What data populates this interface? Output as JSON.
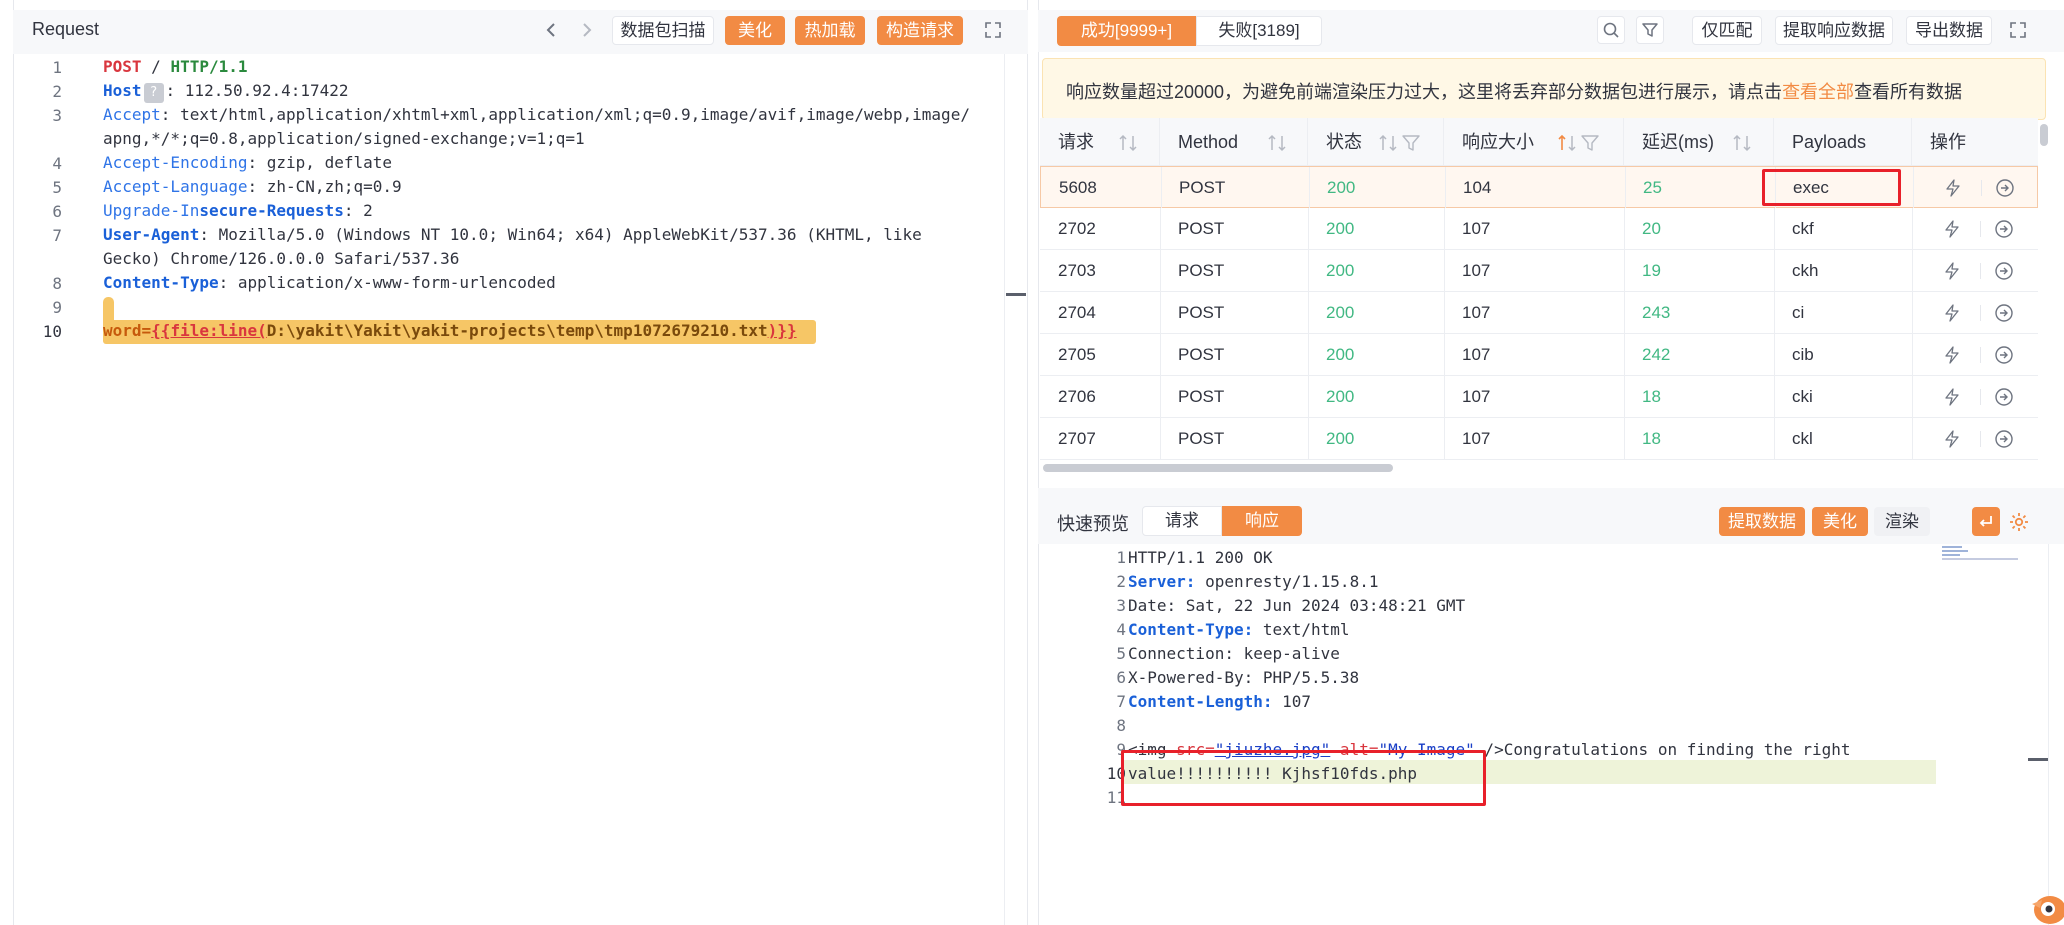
{
  "request_panel": {
    "title": "Request",
    "toolbar": {
      "scan_label": "数据包扫描",
      "beautify_label": "美化",
      "hot_load_label": "热加载",
      "build_request_label": "构造请求"
    },
    "line_numbers": [
      "1",
      "2",
      "3",
      "",
      "4",
      "5",
      "6",
      "7",
      "",
      "8",
      "9",
      "10"
    ],
    "lines": {
      "l1_method": "POST",
      "l1_path": " / ",
      "l1_proto": "HTTP/1.1",
      "l2_key": "Host",
      "l2_badge": "?",
      "l2_val": ": 112.50.92.4:17422",
      "l3_key": "Accept",
      "l3_val": ": text/html,application/xhtml+xml,application/xml;q=0.9,image/avif,image/webp,image/",
      "l3_cont": "apng,*/*;q=0.8,application/signed-exchange;v=1;q=1",
      "l4_key": "Accept-Encoding",
      "l4_val": ": gzip, deflate",
      "l5_key": "Accept-Language",
      "l5_val": ": zh-CN,zh;q=0.9",
      "l6_key_a": "Upgrade-In",
      "l6_key_b": "secure-Requests",
      "l6_val": ": 2",
      "l7_key": "User-Agent",
      "l7_val": ": Mozilla/5.0 (Windows NT 10.0; Win64; x64) AppleWebKit/537.36 (KHTML, like",
      "l7_cont": "Gecko) Chrome/126.0.0.0 Safari/537.36",
      "l8_key": "Content-Type",
      "l8_val": ": application/x-www-form-urlencoded",
      "l10_a": "word=",
      "l10_b": "{{file:line(",
      "l10_c": "D:\\yakit\\Yakit\\yakit-projects\\temp\\tmp1072679210.txt",
      "l10_d": ")}}"
    }
  },
  "results_panel": {
    "tabs": {
      "success": "成功[9999+]",
      "fail": "失败[3189]"
    },
    "toolbar": {
      "only_match": "仅匹配",
      "extract_response": "提取响应数据",
      "export": "导出数据"
    },
    "notice": {
      "text_before": "响应数量超过20000，为避免前端渲染压力过大，这里将丢弃部分数据包进行展示，请点击",
      "link": "查看全部",
      "text_after": "查看所有数据"
    },
    "columns": [
      "请求",
      "Method",
      "状态",
      "响应大小",
      "延迟(ms)",
      "Payloads",
      "操作"
    ],
    "rows": [
      {
        "id": "5608",
        "method": "POST",
        "status": "200",
        "size": "104",
        "latency": "25",
        "payload": "exec"
      },
      {
        "id": "2702",
        "method": "POST",
        "status": "200",
        "size": "107",
        "latency": "20",
        "payload": "ckf"
      },
      {
        "id": "2703",
        "method": "POST",
        "status": "200",
        "size": "107",
        "latency": "19",
        "payload": "ckh"
      },
      {
        "id": "2704",
        "method": "POST",
        "status": "200",
        "size": "107",
        "latency": "243",
        "payload": "ci"
      },
      {
        "id": "2705",
        "method": "POST",
        "status": "200",
        "size": "107",
        "latency": "242",
        "payload": "cib"
      },
      {
        "id": "2706",
        "method": "POST",
        "status": "200",
        "size": "107",
        "latency": "18",
        "payload": "cki"
      },
      {
        "id": "2707",
        "method": "POST",
        "status": "200",
        "size": "107",
        "latency": "18",
        "payload": "ckl"
      }
    ]
  },
  "preview_panel": {
    "label": "快速预览",
    "tab_request": "请求",
    "tab_response": "响应",
    "extract_label": "提取数据",
    "beautify_label": "美化",
    "render_label": "渲染",
    "line_numbers": [
      "1",
      "2",
      "3",
      "4",
      "5",
      "6",
      "7",
      "8",
      "9",
      "",
      "10",
      "11"
    ],
    "lines": {
      "r1": "HTTP/1.1 200 OK",
      "r2_key": "Server:",
      "r2_val": " openresty/1.15.8.1",
      "r3": "Date: Sat, 22 Jun 2024 03:48:21 GMT",
      "r4_key": "Content-Type:",
      "r4_val": " text/html",
      "r5": "Connection: keep-alive",
      "r6": "X-Powered-By: PHP/5.5.38",
      "r7_key": "Content-Length:",
      "r7_val": " 107",
      "r9_a": "<img ",
      "r9_b": "src=",
      "r9_c": "\"jiuzhe.jpg\"",
      "r9_d": " alt=",
      "r9_e": "\"My Image\"",
      "r9_f": " />Congratulations on finding the right",
      "r10": "value!!!!!!!!!! Kjhsf10fds.php"
    }
  },
  "colors": {
    "accent": "#f28b44",
    "status_ok": "#41b883",
    "highlight_box": "#e8202a"
  }
}
